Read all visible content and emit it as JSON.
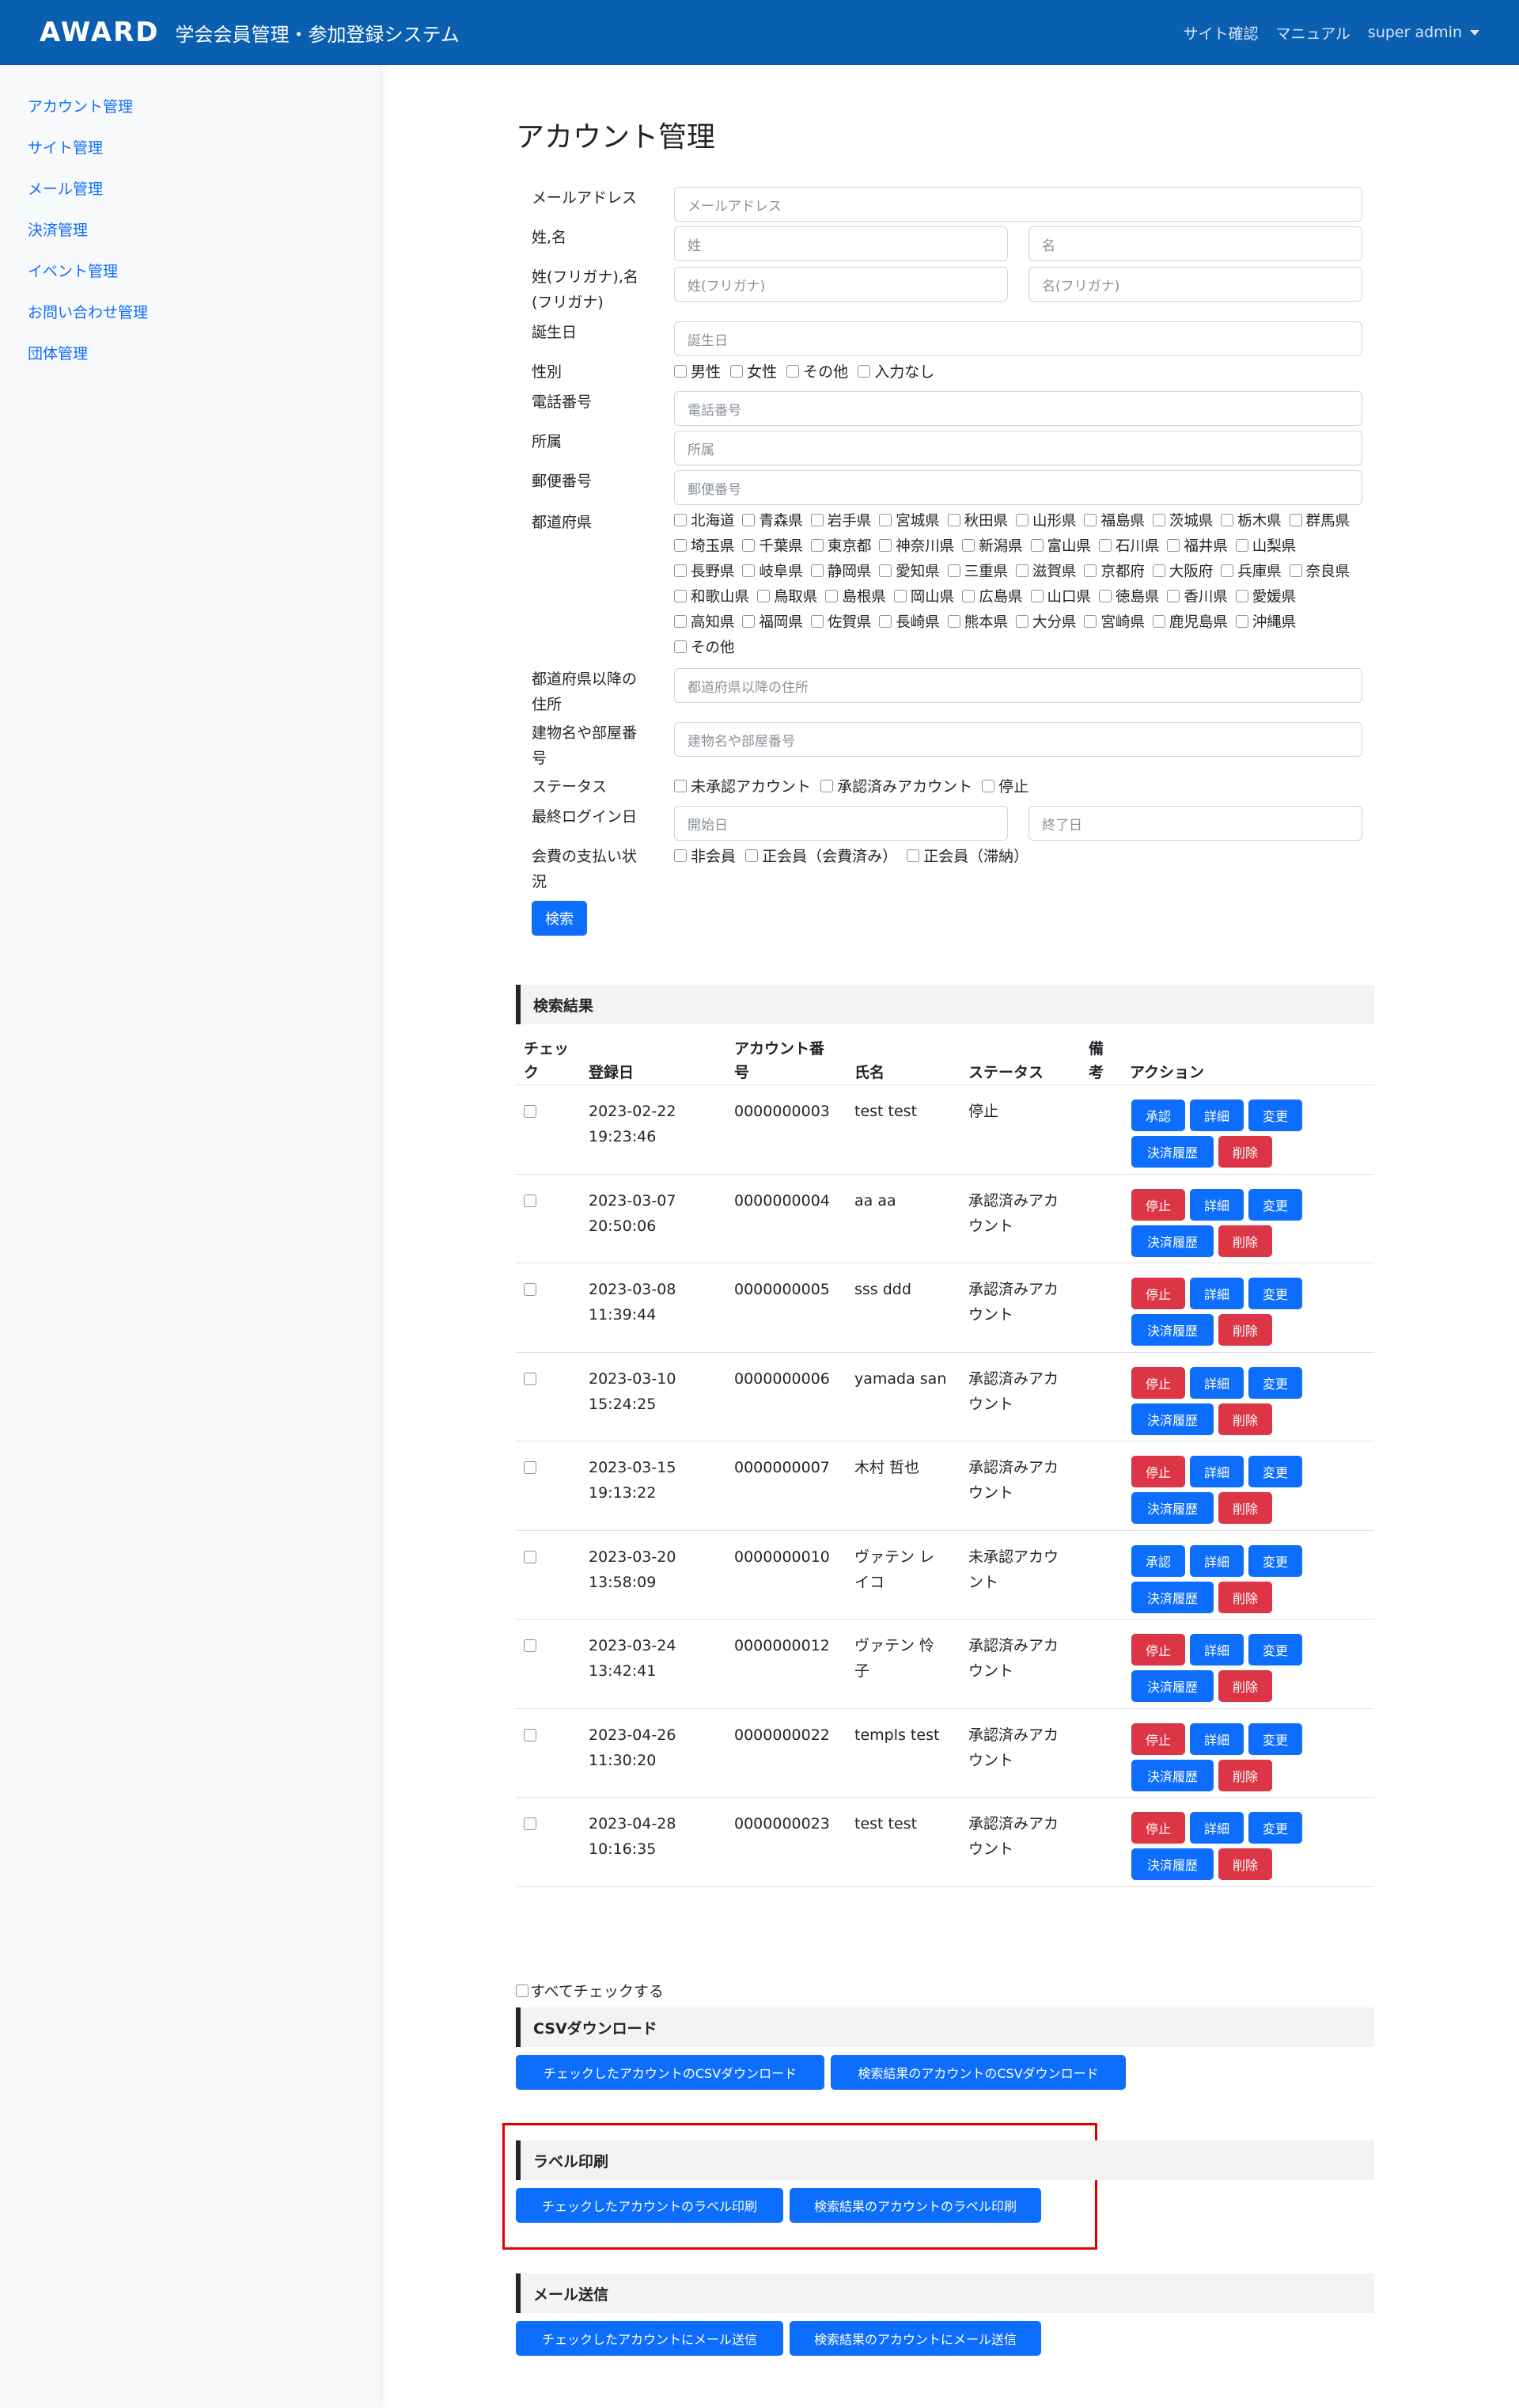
{
  "header": {
    "logo": "AWARD",
    "title": "学会会員管理・参加登録システム",
    "links": [
      "サイト確認",
      "マニュアル"
    ],
    "user": "super admin"
  },
  "sidebar": {
    "items": [
      "アカウント管理",
      "サイト管理",
      "メール管理",
      "決済管理",
      "イベント管理",
      "お問い合わせ管理",
      "団体管理"
    ]
  },
  "page_title": "アカウント管理",
  "form": {
    "email": {
      "label": "メールアドレス",
      "placeholder": "メールアドレス"
    },
    "name": {
      "label": "姓,名",
      "last_placeholder": "姓",
      "first_placeholder": "名"
    },
    "kana": {
      "label_line1": "姓(フリガナ),名",
      "label_line2": "(フリガナ)",
      "last_placeholder": "姓(フリガナ)",
      "first_placeholder": "名(フリガナ)"
    },
    "birthday": {
      "label": "誕生日",
      "placeholder": "誕生日"
    },
    "gender": {
      "label": "性別",
      "options": [
        "男性",
        "女性",
        "その他",
        "入力なし"
      ]
    },
    "phone": {
      "label": "電話番号",
      "placeholder": "電話番号"
    },
    "affiliation": {
      "label": "所属",
      "placeholder": "所属"
    },
    "postal": {
      "label": "郵便番号",
      "placeholder": "郵便番号"
    },
    "prefecture": {
      "label": "都道府県",
      "options": [
        "北海道",
        "青森県",
        "岩手県",
        "宮城県",
        "秋田県",
        "山形県",
        "福島県",
        "茨城県",
        "栃木県",
        "群馬県",
        "埼玉県",
        "千葉県",
        "東京都",
        "神奈川県",
        "新潟県",
        "富山県",
        "石川県",
        "福井県",
        "山梨県",
        "長野県",
        "岐阜県",
        "静岡県",
        "愛知県",
        "三重県",
        "滋賀県",
        "京都府",
        "大阪府",
        "兵庫県",
        "奈良県",
        "和歌山県",
        "鳥取県",
        "島根県",
        "岡山県",
        "広島県",
        "山口県",
        "徳島県",
        "香川県",
        "愛媛県",
        "高知県",
        "福岡県",
        "佐賀県",
        "長崎県",
        "熊本県",
        "大分県",
        "宮崎県",
        "鹿児島県",
        "沖縄県",
        "その他"
      ]
    },
    "address": {
      "label_line1": "都道府県以降の",
      "label_line2": "住所",
      "placeholder": "都道府県以降の住所"
    },
    "building": {
      "label_line1": "建物名や部屋番",
      "label_line2": "号",
      "placeholder": "建物名や部屋番号"
    },
    "status": {
      "label": "ステータス",
      "options": [
        "未承認アカウント",
        "承認済みアカウント",
        "停止"
      ]
    },
    "last_login": {
      "label": "最終ログイン日",
      "start_placeholder": "開始日",
      "end_placeholder": "終了日"
    },
    "fee": {
      "label_line1": "会費の支払い状",
      "label_line2": "況",
      "options": [
        "非会員",
        "正会員（会費済み）",
        "正会員（滞納）"
      ]
    },
    "search_button": "検索"
  },
  "results": {
    "heading": "検索結果",
    "columns": {
      "check_line1": "チェッ",
      "check_line2": "ク",
      "registered": "登録日",
      "account_line1": "アカウント番",
      "account_line2": "号",
      "name": "氏名",
      "status": "ステータス",
      "note_line1": "備",
      "note_line2": "考",
      "action": "アクション"
    },
    "actions": {
      "approve": "承認",
      "stop": "停止",
      "detail": "詳細",
      "edit": "変更",
      "history": "決済履歴",
      "delete": "削除"
    },
    "rows": [
      {
        "date": "2023-02-22",
        "time": "19:23:46",
        "number": "0000000003",
        "name1": "test test",
        "name2": "",
        "status1": "停止",
        "status2": "",
        "first_action": "承認"
      },
      {
        "date": "2023-03-07",
        "time": "20:50:06",
        "number": "0000000004",
        "name1": "aa aa",
        "name2": "",
        "status1": "承認済みアカ",
        "status2": "ウント",
        "first_action": "停止"
      },
      {
        "date": "2023-03-08",
        "time": "11:39:44",
        "number": "0000000005",
        "name1": "sss ddd",
        "name2": "",
        "status1": "承認済みアカ",
        "status2": "ウント",
        "first_action": "停止"
      },
      {
        "date": "2023-03-10",
        "time": "15:24:25",
        "number": "0000000006",
        "name1": "yamada san",
        "name2": "",
        "status1": "承認済みアカ",
        "status2": "ウント",
        "first_action": "停止"
      },
      {
        "date": "2023-03-15",
        "time": "19:13:22",
        "number": "0000000007",
        "name1": "木村 哲也",
        "name2": "",
        "status1": "承認済みアカ",
        "status2": "ウント",
        "first_action": "停止"
      },
      {
        "date": "2023-03-20",
        "time": "13:58:09",
        "number": "0000000010",
        "name1": "ヴァテン レ",
        "name2": "イコ",
        "status1": "未承認アカウ",
        "status2": "ント",
        "first_action": "承認"
      },
      {
        "date": "2023-03-24",
        "time": "13:42:41",
        "number": "0000000012",
        "name1": "ヴァテン 怜",
        "name2": "子",
        "status1": "承認済みアカ",
        "status2": "ウント",
        "first_action": "停止"
      },
      {
        "date": "2023-04-26",
        "time": "11:30:20",
        "number": "0000000022",
        "name1": "templs test",
        "name2": "",
        "status1": "承認済みアカ",
        "status2": "ウント",
        "first_action": "停止"
      },
      {
        "date": "2023-04-28",
        "time": "10:16:35",
        "number": "0000000023",
        "name1": "test test",
        "name2": "",
        "status1": "承認済みアカ",
        "status2": "ウント",
        "first_action": "停止"
      }
    ],
    "check_all": "すべてチェックする"
  },
  "csv": {
    "heading": "CSVダウンロード",
    "checked_button": "チェックしたアカウントのCSVダウンロード",
    "results_button": "検索結果のアカウントのCSVダウンロード"
  },
  "label_print": {
    "heading": "ラベル印刷",
    "checked_button": "チェックしたアカウントのラベル印刷",
    "results_button": "検索結果のアカウントのラベル印刷"
  },
  "mail": {
    "heading": "メール送信",
    "checked_button": "チェックしたアカウントにメール送信",
    "results_button": "検索結果のアカウントにメール送信"
  },
  "colors": {
    "navbar": "#0b5fb0",
    "primary": "#0d6efd",
    "danger": "#dc3545",
    "highlight": "#e00000"
  }
}
